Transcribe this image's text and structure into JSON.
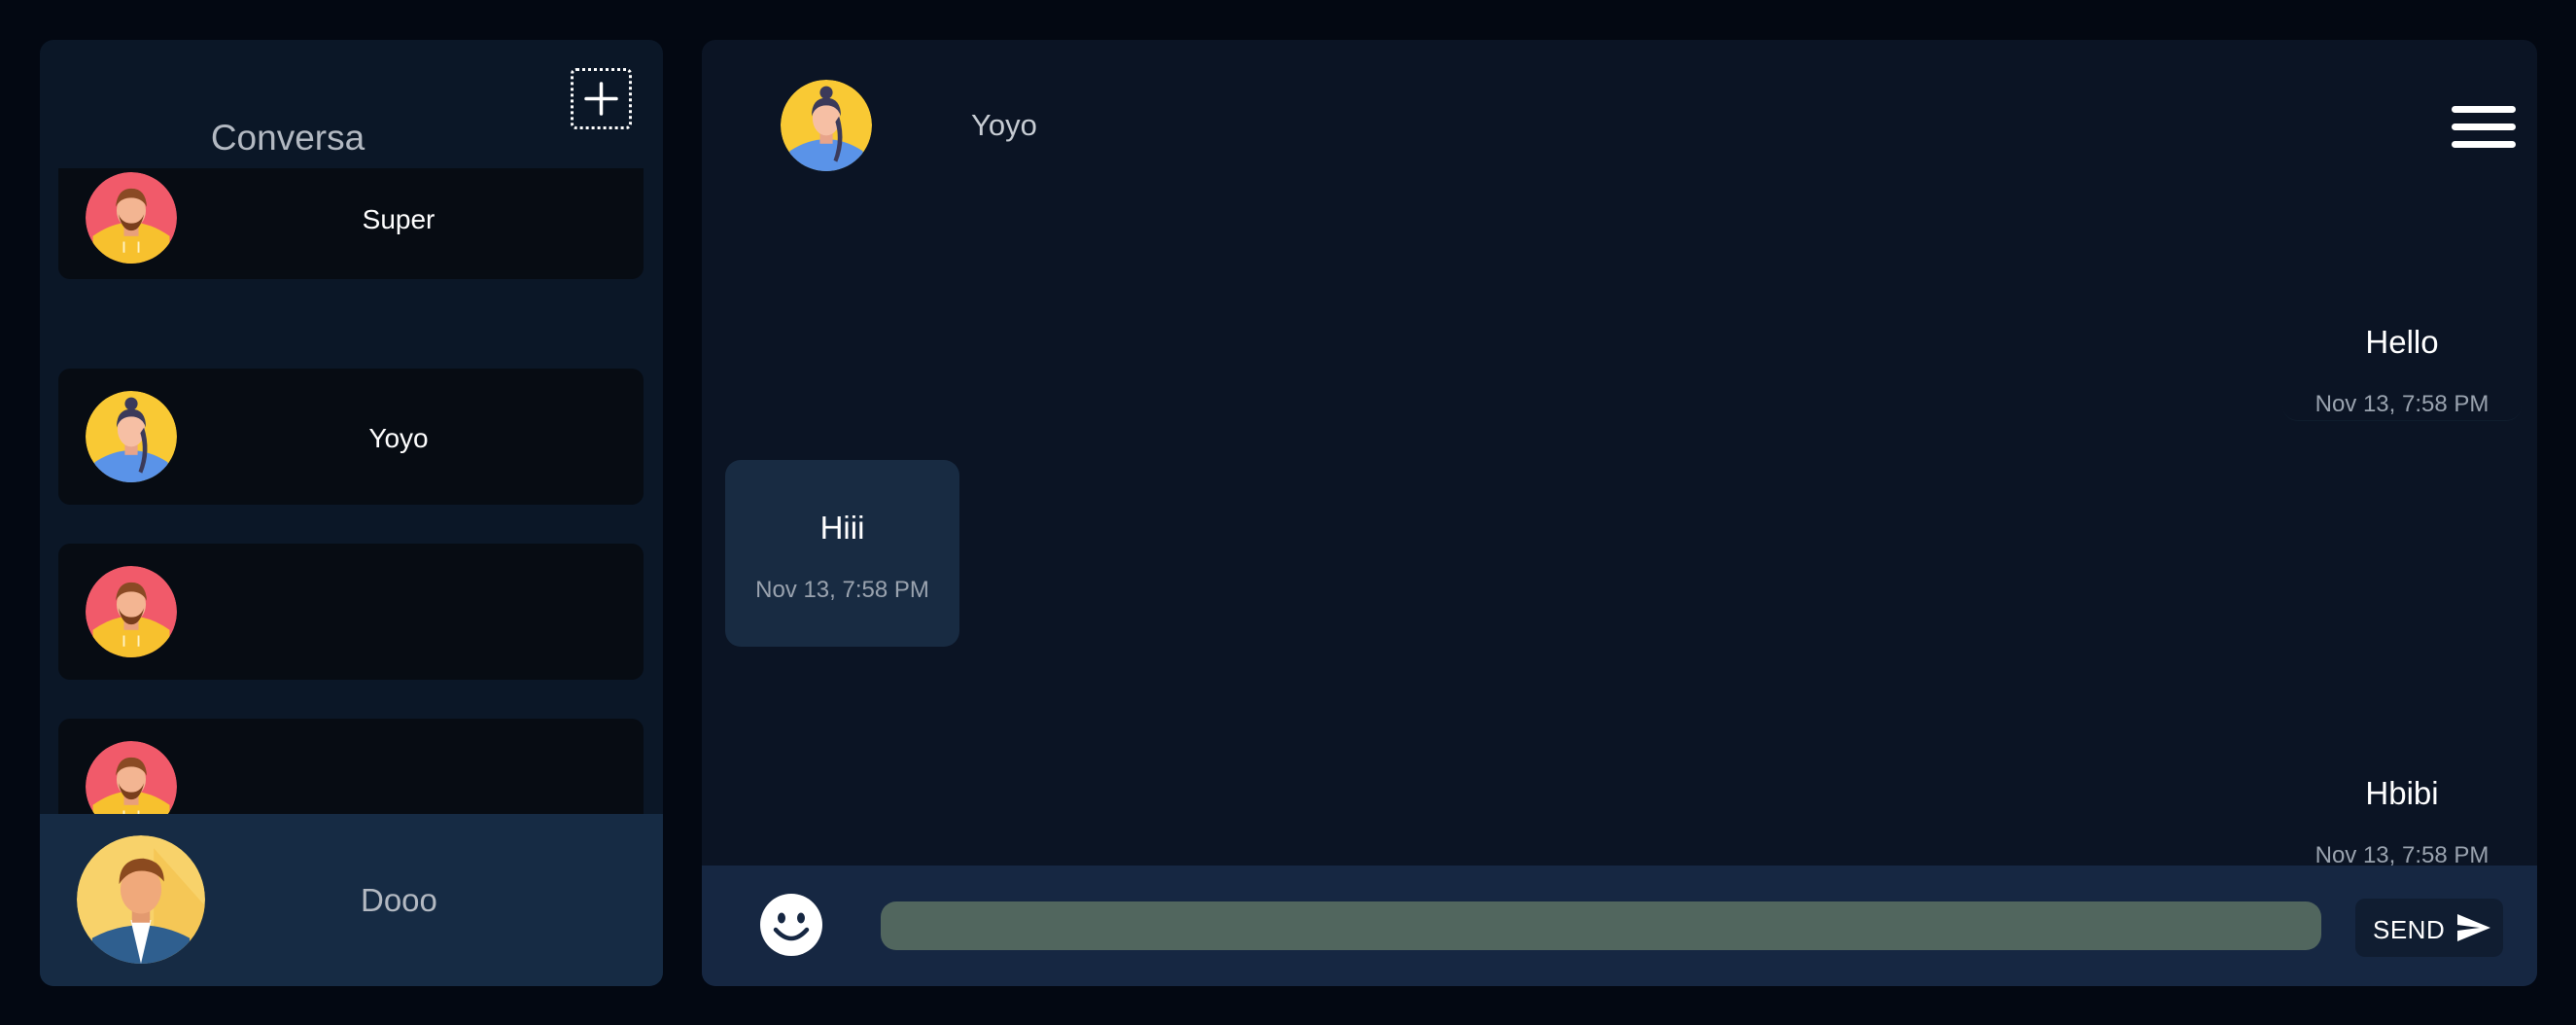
{
  "sidebar": {
    "title": "Conversa",
    "new_button_icon": "plus-icon",
    "conversations": [
      {
        "name": "Super",
        "avatar": "man-beard-avatar"
      },
      {
        "name": "Yoyo",
        "avatar": "woman-ponytail-avatar"
      },
      {
        "name": "",
        "avatar": "man-beard-avatar"
      },
      {
        "name": "",
        "avatar": "man-beard-avatar"
      }
    ],
    "current_user": {
      "name": "Dooo",
      "avatar": "man-suit-avatar"
    }
  },
  "chat": {
    "contact_name": "Yoyo",
    "contact_avatar": "woman-ponytail-avatar",
    "menu_icon": "hamburger-icon",
    "messages": [
      {
        "text": "Hello",
        "time": "Nov 13, 7:58 PM",
        "direction": "sent"
      },
      {
        "text": "Hiii",
        "time": "Nov 13, 7:58 PM",
        "direction": "received"
      },
      {
        "text": "Hbibi",
        "time": "Nov 13, 7:58 PM",
        "direction": "sent"
      }
    ],
    "composer": {
      "input_value": "",
      "input_placeholder": "",
      "emoji_icon": "smiley-icon",
      "send_label": "SEND",
      "send_icon": "paper-plane-icon"
    }
  },
  "colors": {
    "background": "#030812",
    "sidebar_bg": "#0b1727",
    "conversation_item_bg": "#070c13",
    "user_bar_bg": "#162b44",
    "chat_bg": "#0b1424",
    "received_bubble_bg": "#182b42",
    "composer_bg": "#162742",
    "input_bg": "#51665e"
  }
}
